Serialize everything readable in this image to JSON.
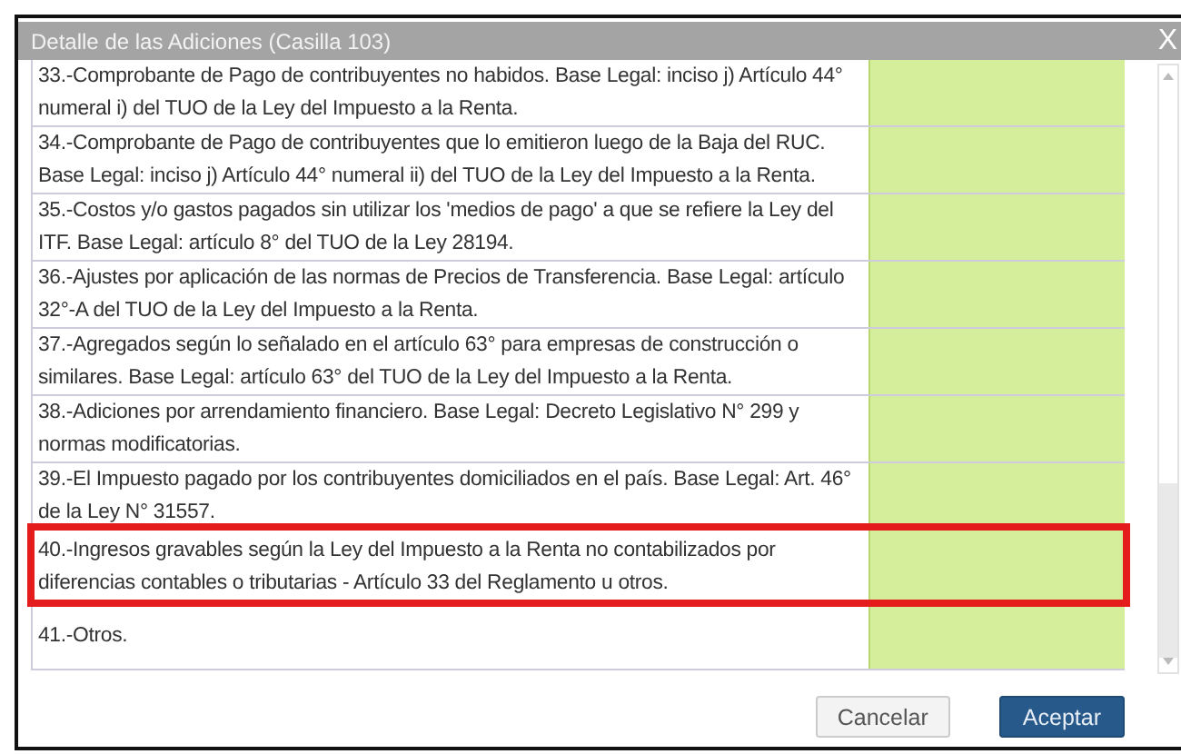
{
  "window": {
    "title": "Detalle de las Adiciones (Casilla 103)",
    "close": "X"
  },
  "rows": [
    {
      "text": "33.-Comprobante de Pago de contribuyentes no habidos. Base Legal: inciso j) Artículo 44° numeral i) del TUO de la Ley del Impuesto a la Renta.",
      "highlighted": false
    },
    {
      "text": "34.-Comprobante de Pago de contribuyentes que lo emitieron luego de la Baja del RUC. Base Legal: inciso j) Artículo 44° numeral ii) del TUO de la Ley del Impuesto a la Renta.",
      "highlighted": false
    },
    {
      "text": "35.-Costos y/o gastos pagados sin utilizar los 'medios de pago' a que se refiere la Ley del ITF. Base Legal: artículo 8° del TUO de la Ley 28194.",
      "highlighted": false
    },
    {
      "text": "36.-Ajustes por aplicación de las normas de Precios de Transferencia. Base Legal: artículo 32°-A del TUO de la Ley del Impuesto a la Renta.",
      "highlighted": false
    },
    {
      "text": "37.-Agregados según lo señalado en el artículo 63° para empresas de construcción o similares. Base Legal: artículo 63° del TUO de la Ley del Impuesto a la Renta.",
      "highlighted": false
    },
    {
      "text": "38.-Adiciones por arrendamiento financiero. Base Legal: Decreto Legislativo N° 299 y normas modificatorias.",
      "highlighted": false
    },
    {
      "text": "39.-El Impuesto pagado por los contribuyentes domiciliados en el país. Base Legal: Art. 46° de la Ley N° 31557.",
      "highlighted": false
    },
    {
      "text": "40.-Ingresos gravables según la Ley del Impuesto a la Renta no contabilizados por diferencias contables o tributarias - Artículo 33 del Reglamento u otros.",
      "highlighted": true
    },
    {
      "text": "41.-Otros.",
      "highlighted": false
    }
  ],
  "buttons": [
    {
      "label": "Cancelar",
      "kind": "secondary"
    },
    {
      "label": "Aceptar",
      "kind": "primary"
    }
  ]
}
